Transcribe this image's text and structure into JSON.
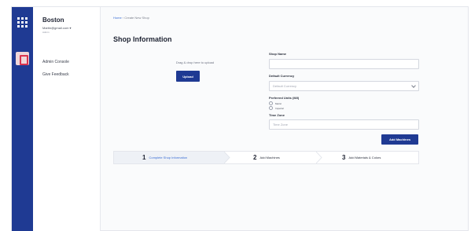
{
  "sidebar": {
    "org_name": "Boston",
    "email": "Martin@gmail.com",
    "role": "Admin",
    "links": [
      "Admin Console",
      "Give Feedback"
    ]
  },
  "breadcrumb": {
    "home": "Home",
    "current": "Create New Shop"
  },
  "page_title": "Shop Information",
  "upload": {
    "drop_text": "Drag & drop here to upload",
    "button": "Upload"
  },
  "form": {
    "shop_name": {
      "label": "Shop Name",
      "value": "",
      "placeholder": ""
    },
    "default_currency": {
      "label": "Default Currency",
      "placeholder": "Default Currency"
    },
    "preferred_units": {
      "label": "Preferred Units (M/I)",
      "options": [
        "Metric",
        "Imperial"
      ]
    },
    "time_zone": {
      "label": "Time Zone",
      "placeholder": "Time Zone"
    },
    "submit": "Add Machines"
  },
  "steps": [
    {
      "num": "1",
      "label": "Complete Shop Information",
      "active": true
    },
    {
      "num": "2",
      "label": "Add Machines",
      "active": false
    },
    {
      "num": "3",
      "label": "Add Materials & Colors",
      "active": false
    }
  ],
  "colors": {
    "brand": "#1f3a93",
    "link": "#3b6ed4",
    "shop_icon": "#d9334f"
  }
}
